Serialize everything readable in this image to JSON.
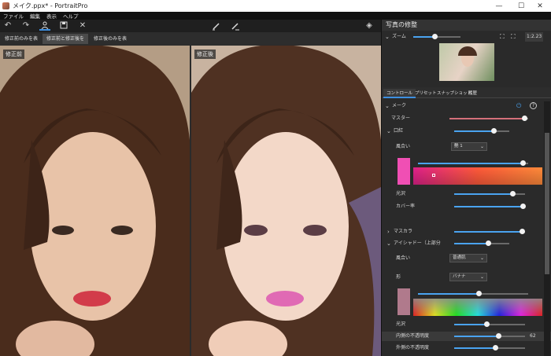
{
  "window": {
    "title": "メイク.ppx* - PortraitPro",
    "minimize": "—",
    "maximize": "☐",
    "close": "✕"
  },
  "menu": [
    "ファイル",
    "編集",
    "表示",
    "ヘルプ"
  ],
  "toolbar": {
    "undo": "↶",
    "redo": "↷",
    "person": "👤",
    "save": "▣",
    "close": "✕",
    "brush1": "⟋",
    "brush2": "⟋",
    "layers": "◈"
  },
  "view_tabs": [
    "修正前のみを表示",
    "修正前と修正後を表示",
    "修正後のみを表示"
  ],
  "panes": {
    "before_label": "修正前",
    "after_label": "修正後"
  },
  "panel": {
    "title": "写真の修整",
    "zoom_label": "ズーム",
    "zoom_value": "1:2.23",
    "zoom_level": 0.45,
    "tabs": [
      "コントロール",
      "プリセット",
      "スナップショット",
      "履歴"
    ],
    "makeup_label": "メーク",
    "master_label": "マスター",
    "master_value": 0.95,
    "lipstick_label": "口紅",
    "lipstick_value": 0.72,
    "hue_label": "風合い",
    "hue_option": "艶 1",
    "lip_gloss_label": "光沢",
    "lip_gloss_value": 0.82,
    "lip_cover_label": "カバー率",
    "lip_cover_value": 0.97,
    "mascara_label": "マスカラ",
    "mascara_value": 0.95,
    "eyeshadow_label": "アイシャドー（上部分",
    "eyeshadow_value": 0.62,
    "eye_hue_label": "風合い",
    "eye_hue_option": "普通肌",
    "shape_label": "形",
    "shape_option": "バナナ",
    "eye_color_value": 0.55,
    "eye_gloss_label": "光沢",
    "eye_gloss_value": 0.45,
    "inner_opacity_label": "内側の不透明度",
    "inner_opacity_value": 62,
    "outer_opacity_label": "外側の不透明度",
    "outer_opacity_value": 0.58
  },
  "colors": {
    "accent": "#3d8fe0",
    "lip_swatch": "#f04fb4",
    "eye_swatch": "#b07a8c"
  },
  "icons": {
    "power": "⏻",
    "help": "?",
    "chev_down": "⌄",
    "chev_right": "›",
    "fit": "⛶"
  }
}
